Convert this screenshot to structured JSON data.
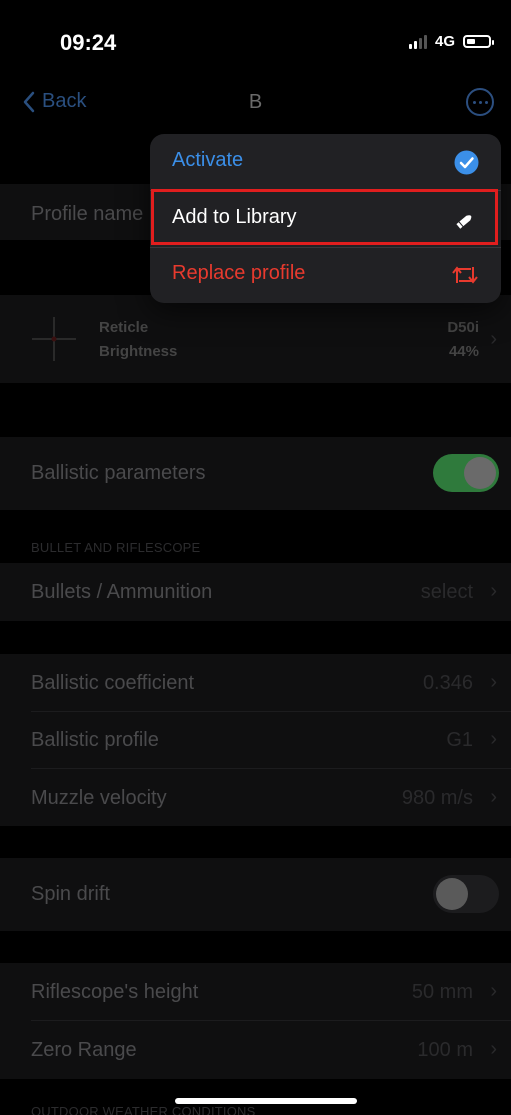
{
  "status_bar": {
    "time": "09:24",
    "network": "4G"
  },
  "nav": {
    "back_label": "Back",
    "title": "B"
  },
  "profile": {
    "name_label": "Profile name"
  },
  "reticle": {
    "label1": "Reticle",
    "label2": "Brightness",
    "value1": "D50i",
    "value2": "44%"
  },
  "ballistic": {
    "label": "Ballistic parameters",
    "enabled": true
  },
  "bullet_section": {
    "header": "BULLET AND RIFLESCOPE",
    "ammo_label": "Bullets / Ammunition",
    "ammo_value": "select"
  },
  "params": {
    "bc_label": "Ballistic coefficient",
    "bc_value": "0.346",
    "profile_label": "Ballistic profile",
    "profile_value": "G1",
    "mv_label": "Muzzle velocity",
    "mv_value": "980 m/s"
  },
  "spin": {
    "label": "Spin drift",
    "enabled": false
  },
  "scope": {
    "height_label": "Riflescope's height",
    "height_value": "50 mm",
    "zero_label": "Zero Range",
    "zero_value": "100 m"
  },
  "outdoor_header": "OUTDOOR WEATHER CONDITIONS",
  "menu": {
    "items": [
      {
        "label": "Activate",
        "icon": "checkmark-circle-icon",
        "color": "#3b8fe8"
      },
      {
        "label": "Add to Library",
        "icon": "bullet-icon",
        "color": "#ffffff"
      },
      {
        "label": "Replace profile",
        "icon": "replace-arrows-icon",
        "color": "#e83a2e"
      }
    ]
  },
  "colors": {
    "accent": "#3b8fe8",
    "destructive": "#e83a2e",
    "toggle_on": "#2f7a3c",
    "highlight_box": "#e11e1e"
  }
}
